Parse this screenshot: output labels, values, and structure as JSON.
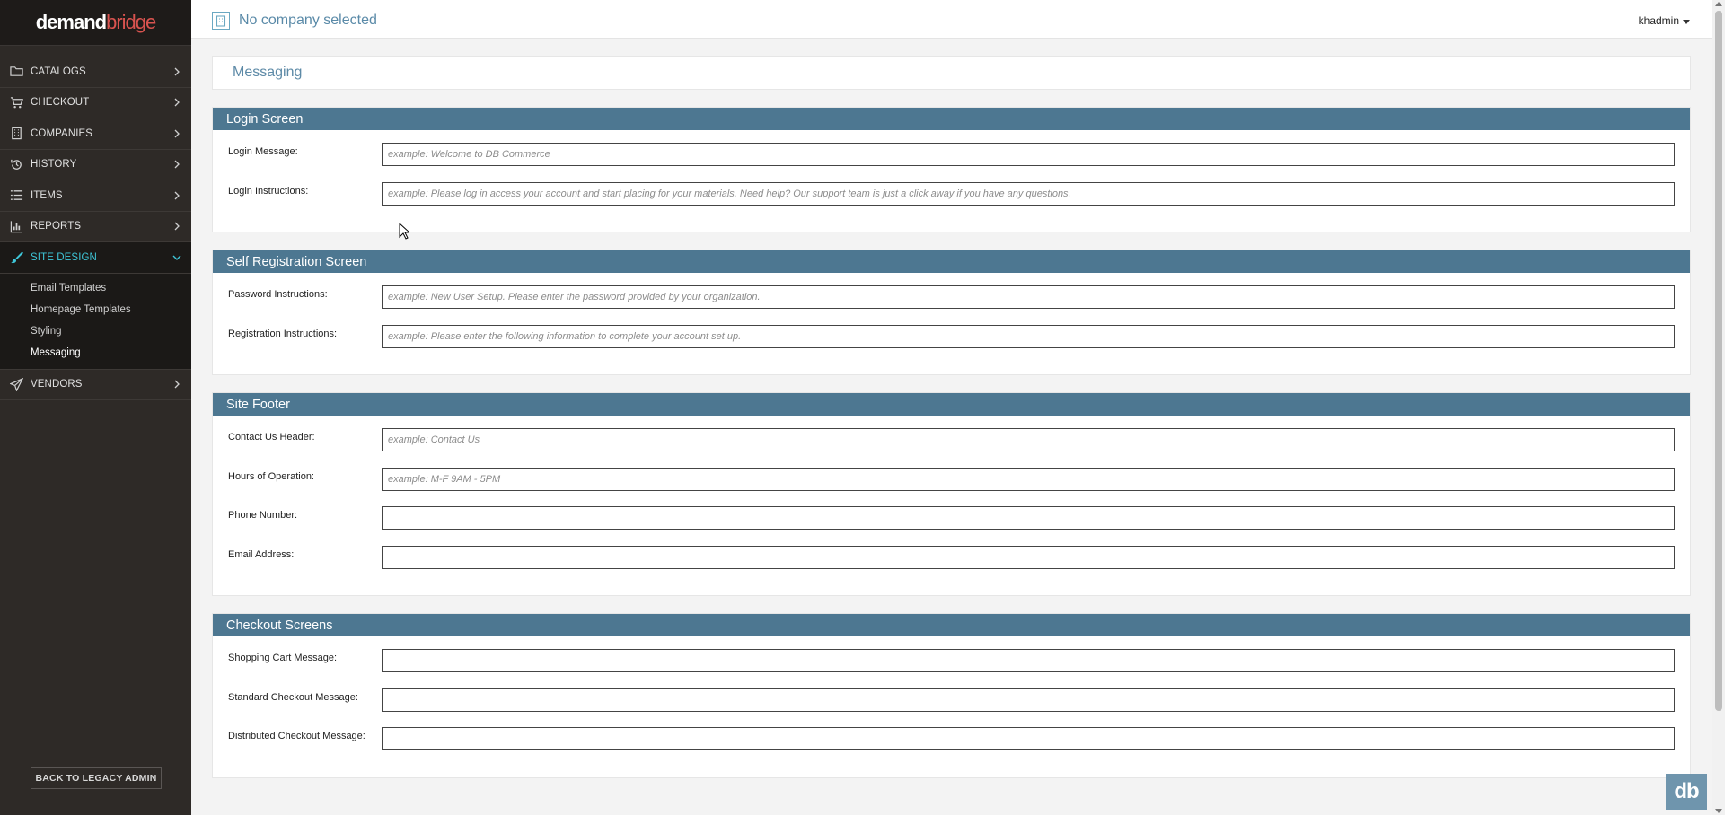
{
  "brand": {
    "logo_main": "demand",
    "logo_accent": "bridge"
  },
  "topbar": {
    "company": "No company selected",
    "user": "khadmin"
  },
  "sidebar": {
    "items": [
      {
        "label": "CATALOGS",
        "icon": "folder-icon"
      },
      {
        "label": "CHECKOUT",
        "icon": "cart-icon"
      },
      {
        "label": "COMPANIES",
        "icon": "building-icon"
      },
      {
        "label": "HISTORY",
        "icon": "history-icon"
      },
      {
        "label": "ITEMS",
        "icon": "list-icon"
      },
      {
        "label": "REPORTS",
        "icon": "bar-chart-icon"
      },
      {
        "label": "SITE DESIGN",
        "icon": "brush-icon",
        "active": true
      },
      {
        "label": "VENDORS",
        "icon": "paper-plane-icon"
      }
    ],
    "site_design_sub": [
      "Email Templates",
      "Homepage Templates",
      "Styling",
      "Messaging"
    ],
    "legacy_button": "BACK TO LEGACY ADMIN"
  },
  "page": {
    "title": "Messaging"
  },
  "sections": [
    {
      "title": "Login Screen",
      "fields": [
        {
          "label": "Login Message:",
          "placeholder": "example: Welcome to DB Commerce",
          "value": ""
        },
        {
          "label": "Login Instructions:",
          "placeholder": "example: Please log in access your account and start placing for your materials. Need help? Our support team is just a click away if you have any questions.",
          "value": ""
        }
      ]
    },
    {
      "title": "Self Registration Screen",
      "fields": [
        {
          "label": "Password Instructions:",
          "placeholder": "example: New User Setup. Please enter the password provided by your organization.",
          "value": ""
        },
        {
          "label": "Registration Instructions:",
          "placeholder": "example: Please enter the following information to complete your account set up.",
          "value": ""
        }
      ]
    },
    {
      "title": "Site Footer",
      "fields": [
        {
          "label": "Contact Us Header:",
          "placeholder": "example: Contact Us",
          "value": ""
        },
        {
          "label": "Hours of Operation:",
          "placeholder": "example: M-F 9AM - 5PM",
          "value": ""
        },
        {
          "label": "Phone Number:",
          "placeholder": "",
          "value": ""
        },
        {
          "label": "Email Address:",
          "placeholder": "",
          "value": ""
        }
      ]
    },
    {
      "title": "Checkout Screens",
      "fields": [
        {
          "label": "Shopping Cart Message:",
          "placeholder": "",
          "value": ""
        },
        {
          "label": "Standard Checkout Message:",
          "placeholder": "",
          "value": ""
        },
        {
          "label": "Distributed Checkout Message:",
          "placeholder": "",
          "value": ""
        }
      ]
    }
  ],
  "badge": "db",
  "colors": {
    "sidebar_bg": "#2e2a27",
    "panel_header": "#4d7791",
    "accent": "#3ec6d8",
    "title": "#5d8aa7"
  }
}
